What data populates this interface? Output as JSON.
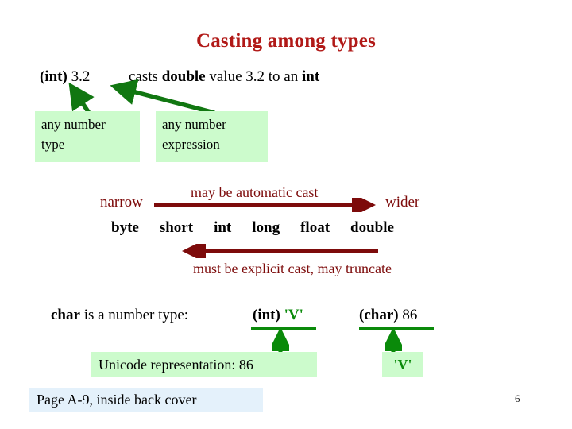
{
  "slide": {
    "title": "Casting among types",
    "page_number": "6"
  },
  "cast_expression": {
    "cast_operator": "(int)",
    "literal": " 3.2",
    "description_pre": "casts ",
    "description_type": "double",
    "description_mid": " value 3.2 to an ",
    "description_target": "int"
  },
  "boxes": {
    "any_number_type": "any number\ntype",
    "any_number_type_line1": "any number",
    "any_number_type_line2": "type",
    "any_number_expression_line1": "any number",
    "any_number_expression_line2": "expression",
    "unicode_representation": "Unicode representation: 86",
    "v_char": "'V'",
    "page_reference": "Page A-9, inside back cover"
  },
  "widening": {
    "narrow_label": "narrow",
    "wider_label": "wider",
    "automatic_cast_label": "may be automatic cast",
    "explicit_cast_label": "must be explicit cast, may truncate",
    "types": [
      "byte",
      "short",
      "int",
      "long",
      "float",
      "double"
    ]
  },
  "char_section": {
    "char_keyword": "char",
    "char_sentence": " is a number type:",
    "int_cast_operator": "(int)",
    "int_cast_value": "'V'",
    "char_cast_operator": "(char)",
    "char_cast_value": " 86"
  },
  "colors": {
    "title_red": "#b11917",
    "dark_red": "#7d0b0b",
    "green": "#0a8a0a",
    "box_green": "#ccfbcc",
    "box_blue": "#e4f1fb"
  }
}
